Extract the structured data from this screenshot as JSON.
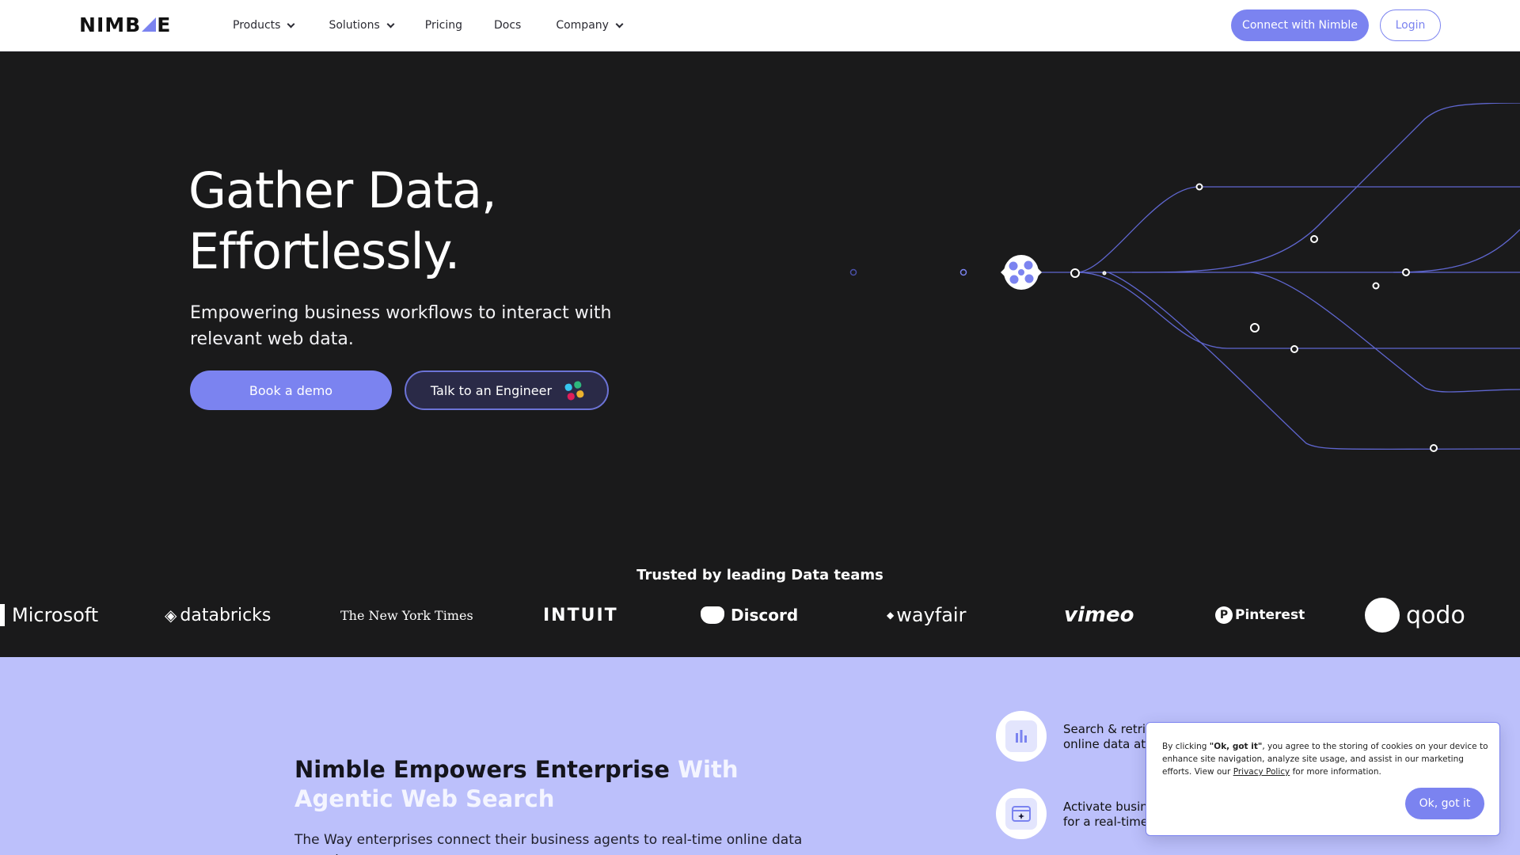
{
  "nav": {
    "logo_text": "NIMBLE",
    "logo_left": "N",
    "logo_mid": "IMB",
    "logo_right": "E",
    "items": [
      {
        "label": "Products",
        "has_dropdown": true
      },
      {
        "label": "Solutions",
        "has_dropdown": true
      },
      {
        "label": "Pricing",
        "has_dropdown": false
      },
      {
        "label": "Docs",
        "has_dropdown": false
      },
      {
        "label": "Company",
        "has_dropdown": true
      }
    ],
    "connect_label": "Connect with Nimble",
    "login_label": "Login"
  },
  "hero": {
    "title_line1": "Gather Data,",
    "title_line2": "Effortlessly.",
    "subtitle": "Empowering business workflows to interact with relevant web data.",
    "demo_label": "Book a demo",
    "engineer_label": "Talk to an Engineer",
    "engineer_icon": "slack-icon"
  },
  "trusted": {
    "title": "Trusted by leading Data teams",
    "logos": [
      "Microsoft",
      "databricks",
      "The New York Times",
      "INTUIT",
      "Discord",
      "wayfair",
      "vimeo",
      "Pinterest",
      "qodo"
    ]
  },
  "section": {
    "title_dark": "Nimble Empowers Enterprise",
    "title_accent": "With Agentic Web Search",
    "description": "The Way enterprises connect their business agents to real-time online data at scale.",
    "features": [
      {
        "icon": "bar-chart-icon",
        "text_line1": "Search & retrie",
        "text_line2": "online data at"
      },
      {
        "icon": "browser-sparkle-icon",
        "text_line1": "Activate busin",
        "text_line2": "for a real-time"
      }
    ]
  },
  "cookie": {
    "prefix": "By clicking ",
    "bold": "\"Ok, got it\"",
    "middle": ", you agree to the storing of cookies on your device to enhance site navigation, analyze site usage, and assist in our marketing efforts. View our ",
    "link": "Privacy Policy",
    "suffix": " for more information.",
    "ok_label": "Ok, got it"
  },
  "colors": {
    "brand": "#7b83f0",
    "hero_bg": "#1a1a1b",
    "section_bg": "#bcc0fb"
  }
}
